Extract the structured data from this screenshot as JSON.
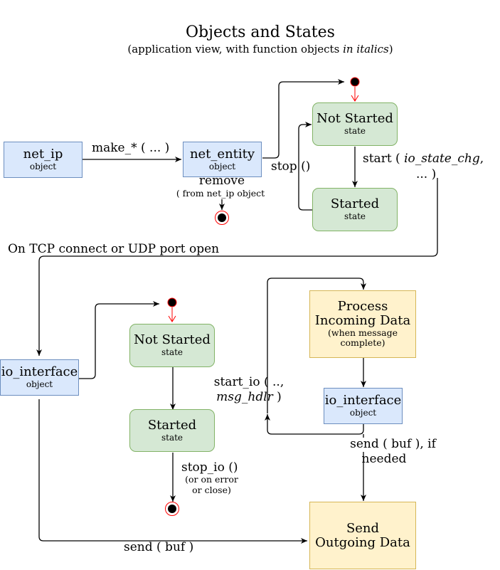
{
  "title": "Objects and States",
  "subtitle": {
    "prefix": "(application view, with function objects ",
    "italic": "in italics",
    "suffix": ")"
  },
  "objects": {
    "net_ip": {
      "name": "net_ip",
      "kind": "object"
    },
    "net_entity": {
      "name": "net_entity",
      "kind": "object"
    },
    "io_interface_left": {
      "name": "io_interface",
      "kind": "object"
    },
    "io_interface_right": {
      "name": "io_interface",
      "kind": "object"
    }
  },
  "states": {
    "top_not_started": {
      "name": "Not Started",
      "kind": "state"
    },
    "top_started": {
      "name": "Started",
      "kind": "state"
    },
    "bottom_not_started": {
      "name": "Not Started",
      "kind": "state"
    },
    "bottom_started": {
      "name": "Started",
      "kind": "state"
    }
  },
  "processes": {
    "incoming": {
      "line1": "Process",
      "line2": "Incoming Data",
      "note1": "(when message",
      "note2": "complete)"
    },
    "outgoing": {
      "line1": "Send",
      "line2": "Outgoing Data"
    }
  },
  "edges": {
    "make": "make_* ( ... )",
    "remove": "remove",
    "remove_note": "( from net_ip object",
    "stop": "stop ()",
    "start_prefix": "start ( ",
    "start_italic": "io_state_chg",
    "start_suffix": ",",
    "start_line2": "... )",
    "on_connect": "On TCP connect or UDP port open",
    "start_io_line1": "start_io ( ..,",
    "start_io_italic": "msg_hdlr",
    "start_io_suffix": " )",
    "stop_io": "stop_io ()",
    "stop_io_note1": "(or on error",
    "stop_io_note2": "or close)",
    "send_if_line1": "send ( buf ), if",
    "send_if_line2": "needed",
    "send": "send ( buf )"
  },
  "colors": {
    "object_fill": "#dae8fc",
    "object_stroke": "#6c8ebf",
    "state_fill": "#d5e8d4",
    "state_stroke": "#82b366",
    "process_fill": "#fff2cc",
    "process_stroke": "#d6b656",
    "initial_final_red": "#ff0000"
  }
}
